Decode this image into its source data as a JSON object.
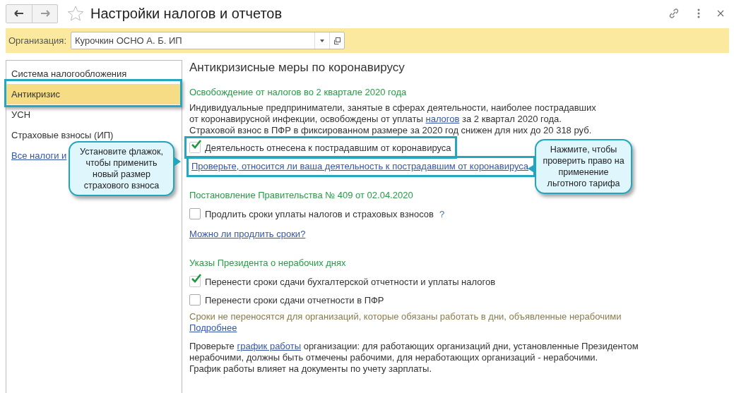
{
  "window": {
    "title": "Настройки налогов и отчетов"
  },
  "organization": {
    "label": "Организация:",
    "value": "Курочкин ОСНО А. Б. ИП"
  },
  "sidebar": {
    "items": [
      {
        "label": "Система налогообложения",
        "selected": false
      },
      {
        "label": "Антикризис",
        "selected": true
      },
      {
        "label": "УСН",
        "selected": false
      },
      {
        "label": "Страховые взносы (ИП)",
        "selected": false
      }
    ],
    "link": "Все налоги и"
  },
  "content": {
    "heading": "Антикризисные меры по коронавирусу",
    "sections": [
      {
        "title": "Освобождение от налогов во 2 квартале 2020 года",
        "blocks": [
          {
            "kind": "text",
            "text": "Индивидуальные предприниматели, занятые в сферах деятельности, наиболее пострадавших\nот коронавирусной инфекции, освобождены от уплаты ",
            "link": "налогов",
            "after": " за 2 квартал 2020 года.\nСтраховой взнос в ПФР в фиксированном размере за 2020 год снижен для них до 20 318 руб."
          },
          {
            "kind": "checkbox",
            "label": "Деятельность отнесена к пострадавшим от коронавируса",
            "checked": true,
            "highlighted": true
          },
          {
            "kind": "link",
            "text": "Проверьте, относится ли ваша деятельность к пострадавшим от коронавируса",
            "highlighted": true
          }
        ]
      },
      {
        "title": "Постановление Правительства № 409 от 02.04.2020",
        "blocks": [
          {
            "kind": "checkbox",
            "label": "Продлить сроки уплаты налогов и страховых взносов",
            "checked": false,
            "help": "?"
          },
          {
            "kind": "link",
            "text": "Можно ли продлить сроки?"
          }
        ]
      },
      {
        "title": "Указы Президента о нерабочих днях",
        "blocks": [
          {
            "kind": "checkbox",
            "label": "Перенести сроки сдачи бухгалтерской отчетности и уплаты налогов",
            "checked": true
          },
          {
            "kind": "checkbox",
            "label": "Перенести сроки сдачи отчетности в ПФР",
            "checked": false
          },
          {
            "kind": "note",
            "text": "Сроки не переносятся для организаций, которые обязаны работать в дни, объявленные нерабочими",
            "link": "Подробнее"
          },
          {
            "kind": "text",
            "text": "Проверьте ",
            "link": "график работы",
            "after": " организации: для работающих организаций дни, установленные Президентом\nнерабочими, должны быть отмечены рабочими, для неработающих организаций - нерабочими.\nГрафик работы влияет на документы по учету зарплаты."
          }
        ]
      }
    ]
  },
  "callouts": [
    {
      "text": "Установите флажок, чтобы применить новый размер страхового взноса"
    },
    {
      "text": "Нажмите, чтобы проверить право на применение льготного тарифа"
    }
  ]
}
